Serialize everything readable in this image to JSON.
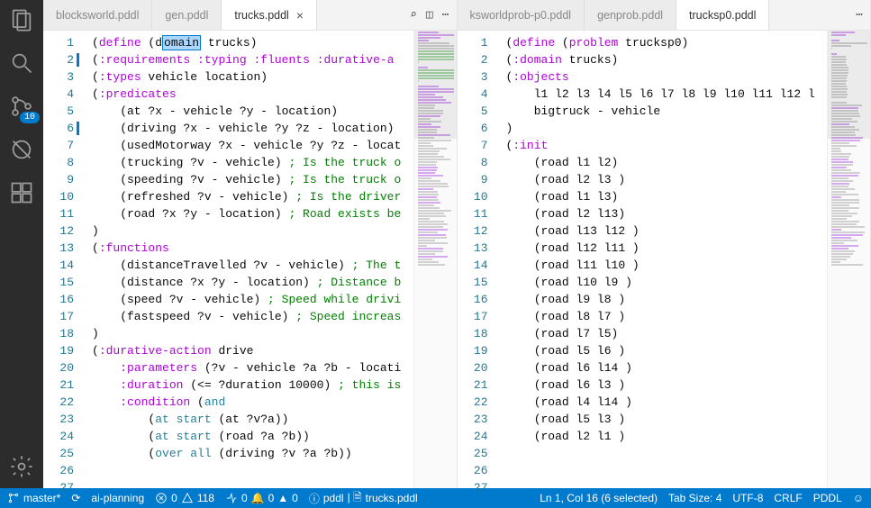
{
  "activity_badge": "10",
  "left_tabs": [
    {
      "label": "blocksworld.pddl",
      "active": false
    },
    {
      "label": "gen.pddl",
      "active": false
    },
    {
      "label": "trucks.pddl",
      "active": true
    }
  ],
  "right_tabs": [
    {
      "label": "ksworldprob-p0.pddl",
      "active": false
    },
    {
      "label": "genprob.pddl",
      "active": false
    },
    {
      "label": "trucksp0.pddl",
      "active": true
    }
  ],
  "left_code": {
    "lines": [
      {
        "n": 1,
        "mod": false,
        "segs": [
          [
            "(",
            "p"
          ],
          [
            "define",
            "kw"
          ],
          [
            " (",
            "p"
          ],
          [
            "d",
            "p"
          ],
          [
            "omain",
            "hl"
          ],
          [
            " trucks)",
            "p"
          ]
        ]
      },
      {
        "n": 2,
        "mod": true,
        "segs": [
          [
            "(",
            "p"
          ],
          [
            ":requirements",
            "kw"
          ],
          [
            " ",
            "p"
          ],
          [
            ":typing",
            "kw"
          ],
          [
            " ",
            "p"
          ],
          [
            ":fluents",
            "kw"
          ],
          [
            " ",
            "p"
          ],
          [
            ":durative-a",
            "kw"
          ]
        ]
      },
      {
        "n": 3,
        "mod": false,
        "segs": [
          [
            "(",
            "p"
          ],
          [
            ":types",
            "kw"
          ],
          [
            " vehicle location)",
            "p"
          ]
        ]
      },
      {
        "n": 4,
        "mod": false,
        "segs": [
          [
            "(",
            "p"
          ],
          [
            ":predicates",
            "kw"
          ]
        ]
      },
      {
        "n": 5,
        "mod": false,
        "segs": [
          [
            "    (at ?x - vehicle ?y - location)",
            "p"
          ]
        ]
      },
      {
        "n": 6,
        "mod": true,
        "segs": [
          [
            "    (driving ?x - vehicle ?y ?z - location)",
            "p"
          ]
        ]
      },
      {
        "n": 7,
        "mod": false,
        "segs": [
          [
            "    (usedMotorway ?x - vehicle ?y ?z - locat",
            "p"
          ]
        ]
      },
      {
        "n": 8,
        "mod": false,
        "segs": [
          [
            "    (trucking ?v - vehicle) ",
            "p"
          ],
          [
            "; Is the truck o",
            "cm"
          ]
        ]
      },
      {
        "n": 9,
        "mod": false,
        "segs": [
          [
            "    (speeding ?v - vehicle) ",
            "p"
          ],
          [
            "; Is the truck o",
            "cm"
          ]
        ]
      },
      {
        "n": 10,
        "mod": false,
        "segs": [
          [
            "    (refreshed ?v - vehicle) ",
            "p"
          ],
          [
            "; Is the driver",
            "cm"
          ]
        ]
      },
      {
        "n": 11,
        "mod": false,
        "segs": [
          [
            "    (road ?x ?y - location) ",
            "p"
          ],
          [
            "; Road exists be",
            "cm"
          ]
        ]
      },
      {
        "n": 12,
        "mod": false,
        "segs": [
          [
            ")",
            "p"
          ]
        ]
      },
      {
        "n": 13,
        "mod": false,
        "segs": [
          [
            "",
            "p"
          ]
        ]
      },
      {
        "n": 14,
        "mod": false,
        "segs": [
          [
            "(",
            "p"
          ],
          [
            ":functions",
            "kw"
          ]
        ]
      },
      {
        "n": 15,
        "mod": false,
        "segs": [
          [
            "    (distanceTravelled ?v - vehicle) ",
            "p"
          ],
          [
            "; The t",
            "cm"
          ]
        ]
      },
      {
        "n": 16,
        "mod": false,
        "segs": [
          [
            "    (distance ?x ?y - location) ",
            "p"
          ],
          [
            "; Distance b",
            "cm"
          ]
        ]
      },
      {
        "n": 17,
        "mod": false,
        "segs": [
          [
            "    (speed ?v - vehicle) ",
            "p"
          ],
          [
            "; Speed while drivi",
            "cm"
          ]
        ]
      },
      {
        "n": 18,
        "mod": false,
        "segs": [
          [
            "    (fastspeed ?v - vehicle) ",
            "p"
          ],
          [
            "; Speed increas",
            "cm"
          ]
        ]
      },
      {
        "n": 19,
        "mod": false,
        "segs": [
          [
            ")",
            "p"
          ]
        ]
      },
      {
        "n": 20,
        "mod": false,
        "segs": [
          [
            "",
            "p"
          ]
        ]
      },
      {
        "n": 21,
        "mod": false,
        "segs": [
          [
            "(",
            "p"
          ],
          [
            ":durative-action",
            "kw"
          ],
          [
            " drive",
            "p"
          ]
        ]
      },
      {
        "n": 22,
        "mod": false,
        "segs": [
          [
            "    ",
            "p"
          ],
          [
            ":parameters",
            "kw"
          ],
          [
            " (?v - vehicle ?a ?b - locati",
            "p"
          ]
        ]
      },
      {
        "n": 23,
        "mod": false,
        "segs": [
          [
            "    ",
            "p"
          ],
          [
            ":duration",
            "kw"
          ],
          [
            " (<= ?duration 10000) ",
            "p"
          ],
          [
            "; this is",
            "cm"
          ]
        ]
      },
      {
        "n": 24,
        "mod": false,
        "segs": [
          [
            "    ",
            "p"
          ],
          [
            ":condition",
            "kw"
          ],
          [
            " (",
            "p"
          ],
          [
            "and",
            "sc"
          ]
        ]
      },
      {
        "n": 25,
        "mod": false,
        "segs": [
          [
            "        (",
            "p"
          ],
          [
            "at start",
            "sc"
          ],
          [
            " (at ?v?a))",
            "p"
          ]
        ]
      },
      {
        "n": 26,
        "mod": false,
        "segs": [
          [
            "        (",
            "p"
          ],
          [
            "at start",
            "sc"
          ],
          [
            " (road ?a ?b))",
            "p"
          ]
        ]
      },
      {
        "n": 27,
        "mod": false,
        "segs": [
          [
            "        (",
            "p"
          ],
          [
            "over all",
            "sc"
          ],
          [
            " (driving ?v ?a ?b))",
            "p"
          ]
        ]
      }
    ]
  },
  "right_code": {
    "lines": [
      {
        "n": 1,
        "segs": [
          [
            "(",
            "p"
          ],
          [
            "define",
            "kw"
          ],
          [
            " (",
            "p"
          ],
          [
            "problem",
            "kw"
          ],
          [
            " trucksp0)",
            "p"
          ]
        ]
      },
      {
        "n": 2,
        "segs": [
          [
            "(",
            "p"
          ],
          [
            ":domain",
            "kw"
          ],
          [
            " trucks)",
            "p"
          ]
        ]
      },
      {
        "n": 3,
        "segs": [
          [
            "",
            "p"
          ]
        ]
      },
      {
        "n": 4,
        "segs": [
          [
            "(",
            "p"
          ],
          [
            ":objects",
            "kw"
          ]
        ]
      },
      {
        "n": 5,
        "segs": [
          [
            "    l1 l2 l3 l4 l5 l6 l7 l8 l9 l10 l11 l12 l",
            "p"
          ]
        ]
      },
      {
        "n": 6,
        "segs": [
          [
            "    bigtruck - vehicle",
            "p"
          ]
        ]
      },
      {
        "n": 7,
        "segs": [
          [
            ")",
            "p"
          ]
        ]
      },
      {
        "n": 8,
        "segs": [
          [
            "",
            "p"
          ]
        ]
      },
      {
        "n": 9,
        "segs": [
          [
            "(",
            "p"
          ],
          [
            ":init",
            "kw"
          ]
        ]
      },
      {
        "n": 10,
        "segs": [
          [
            "    (road l1 l2)",
            "p"
          ]
        ]
      },
      {
        "n": 11,
        "segs": [
          [
            "    (road l2 l3 )",
            "p"
          ]
        ]
      },
      {
        "n": 12,
        "segs": [
          [
            "    (road l1 l3)",
            "p"
          ]
        ]
      },
      {
        "n": 13,
        "segs": [
          [
            "    (road l2 l13)",
            "p"
          ]
        ]
      },
      {
        "n": 14,
        "segs": [
          [
            "    (road l13 l12 )",
            "p"
          ]
        ]
      },
      {
        "n": 15,
        "segs": [
          [
            "    (road l12 l11 )",
            "p"
          ]
        ]
      },
      {
        "n": 16,
        "segs": [
          [
            "    (road l11 l10 )",
            "p"
          ]
        ]
      },
      {
        "n": 17,
        "segs": [
          [
            "    (road l10 l9 )",
            "p"
          ]
        ]
      },
      {
        "n": 18,
        "segs": [
          [
            "    (road l9 l8 )",
            "p"
          ]
        ]
      },
      {
        "n": 19,
        "segs": [
          [
            "    (road l8 l7 )",
            "p"
          ]
        ]
      },
      {
        "n": 20,
        "segs": [
          [
            "    (road l7 l5)",
            "p"
          ]
        ]
      },
      {
        "n": 21,
        "segs": [
          [
            "    (road l5 l6 )",
            "p"
          ]
        ]
      },
      {
        "n": 22,
        "segs": [
          [
            "    (road l6 l14 )",
            "p"
          ]
        ]
      },
      {
        "n": 23,
        "segs": [
          [
            "    (road l6 l3 )",
            "p"
          ]
        ]
      },
      {
        "n": 24,
        "segs": [
          [
            "    (road l4 l14 )",
            "p"
          ]
        ]
      },
      {
        "n": 25,
        "segs": [
          [
            "    (road l5 l3 )",
            "p"
          ]
        ]
      },
      {
        "n": 26,
        "segs": [
          [
            "",
            "p"
          ]
        ]
      },
      {
        "n": 27,
        "segs": [
          [
            "    (road l2 l1 )",
            "p"
          ]
        ]
      }
    ]
  },
  "status": {
    "branch": "master*",
    "sync": "⟳",
    "env": "ai-planning",
    "errors": "0",
    "warnings": "118",
    "port": "0",
    "bell": "0",
    "flame": "0",
    "lang_badge": "pddl",
    "file": "trucks.pddl",
    "cursor": "Ln 1, Col 16 (6 selected)",
    "tabsize": "Tab Size: 4",
    "encoding": "UTF-8",
    "eol": "CRLF",
    "lang": "PDDL"
  }
}
